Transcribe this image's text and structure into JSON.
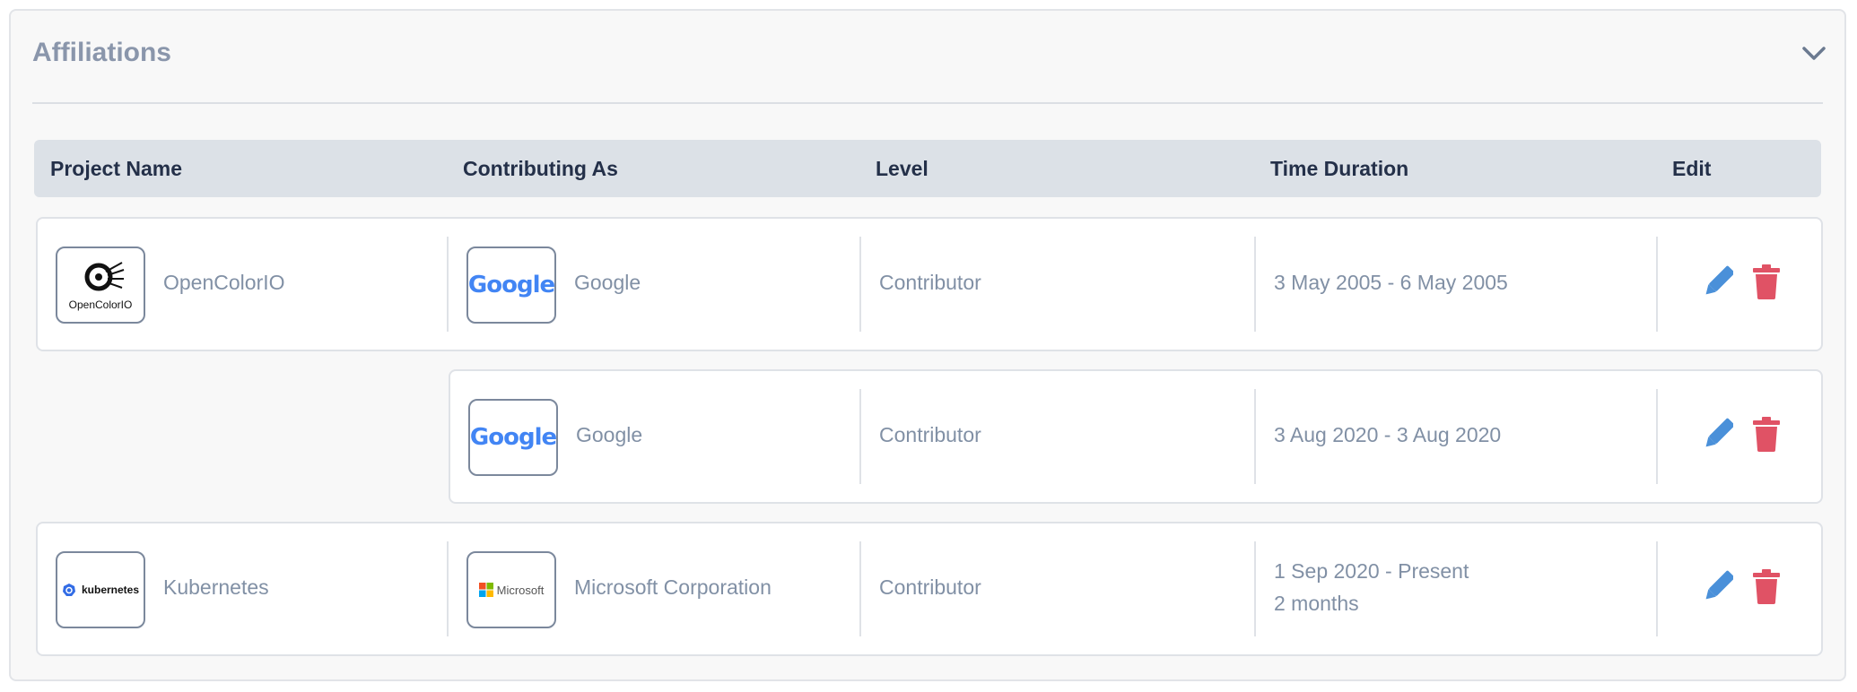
{
  "panel": {
    "title": "Affiliations"
  },
  "table": {
    "headers": [
      "Project Name",
      "Contributing As",
      "Level",
      "Time Duration",
      "Edit"
    ]
  },
  "rows": [
    {
      "project": {
        "name": "OpenColorIO",
        "logo_text": "OpenColorIO"
      },
      "org": {
        "name": "Google",
        "logo_text": "Google"
      },
      "level": "Contributor",
      "duration": "3 May 2005 - 6 May 2005",
      "duration_extra": ""
    },
    {
      "project": null,
      "org": {
        "name": "Google",
        "logo_text": "Google"
      },
      "level": "Contributor",
      "duration": "3 Aug 2020 - 3 Aug 2020",
      "duration_extra": ""
    },
    {
      "project": {
        "name": "Kubernetes",
        "logo_text": "kubernetes"
      },
      "org": {
        "name": "Microsoft Corporation",
        "logo_text": "Microsoft"
      },
      "level": "Contributor",
      "duration": "1 Sep 2020 - Present",
      "duration_extra": "2 months"
    }
  ],
  "colors": {
    "edit": "#4a90d9",
    "delete": "#e05265",
    "header_bg": "#dce1e7"
  },
  "icons": {
    "collapse": "chevron-down-icon",
    "edit": "pencil-icon",
    "delete": "trash-icon"
  }
}
